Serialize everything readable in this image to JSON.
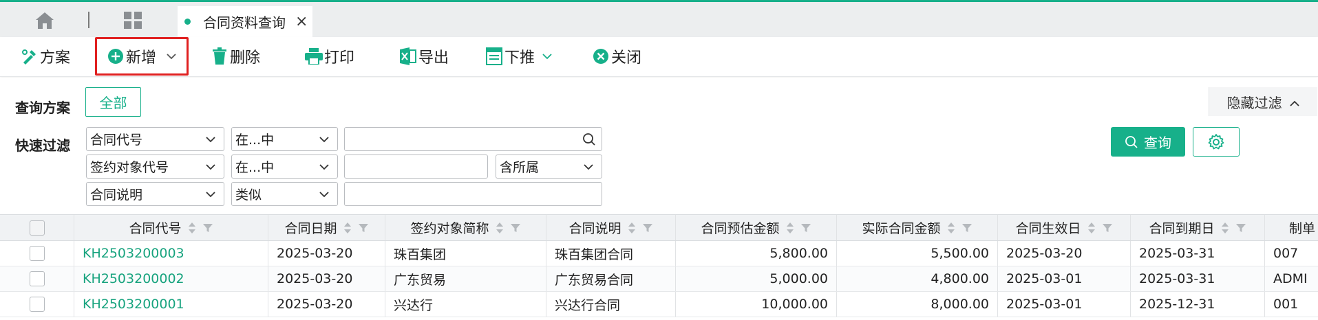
{
  "tabs": {
    "active_label": "合同资料查询",
    "close_glyph": "×"
  },
  "toolbar": {
    "buttons": [
      {
        "label": "方案",
        "icon": "scheme-icon"
      },
      {
        "label": "新增",
        "icon": "add-circle-icon",
        "has_dropdown": true,
        "highlighted": true
      },
      {
        "label": "删除",
        "icon": "trash-icon"
      },
      {
        "label": "打印",
        "icon": "printer-icon"
      },
      {
        "label": "导出",
        "icon": "excel-export-icon"
      },
      {
        "label": "下推",
        "icon": "push-down-icon",
        "has_dropdown": true
      },
      {
        "label": "关闭",
        "icon": "close-circle-icon"
      }
    ],
    "highlight_color": "#e02020"
  },
  "filter": {
    "scheme_label": "查询方案",
    "scheme_all": "全部",
    "quick_label": "快速过滤",
    "hide_filter": "隐藏过滤",
    "query_button": "查询",
    "rows": [
      {
        "field": "合同代号",
        "operator": "在...中",
        "value": ""
      },
      {
        "field": "签约对象代号",
        "operator": "在...中",
        "value": "",
        "extra": "含所属"
      },
      {
        "field": "合同说明",
        "operator": "类似",
        "value": ""
      }
    ]
  },
  "grid": {
    "headers": [
      "合同代号",
      "合同日期",
      "签约对象简称",
      "合同说明",
      "合同预估金额",
      "实际合同金额",
      "合同生效日",
      "合同到期日",
      "制单"
    ],
    "rows": [
      [
        "KH2503200003",
        "2025-03-20",
        "珠百集团",
        "珠百集团合同",
        "5,800.00",
        "5,500.00",
        "2025-03-20",
        "2025-03-31",
        "007"
      ],
      [
        "KH2503200002",
        "2025-03-20",
        "广东贸易",
        "广东贸易合同",
        "5,000.00",
        "4,800.00",
        "2025-03-01",
        "2025-03-31",
        "ADMI"
      ],
      [
        "KH2503200001",
        "2025-03-20",
        "兴达行",
        "兴达行合同",
        "10,000.00",
        "8,000.00",
        "2025-03-01",
        "2025-12-31",
        "001"
      ]
    ]
  },
  "colors": {
    "accent": "#17b08a",
    "link": "#17a37e",
    "highlight_border": "#e02020"
  }
}
